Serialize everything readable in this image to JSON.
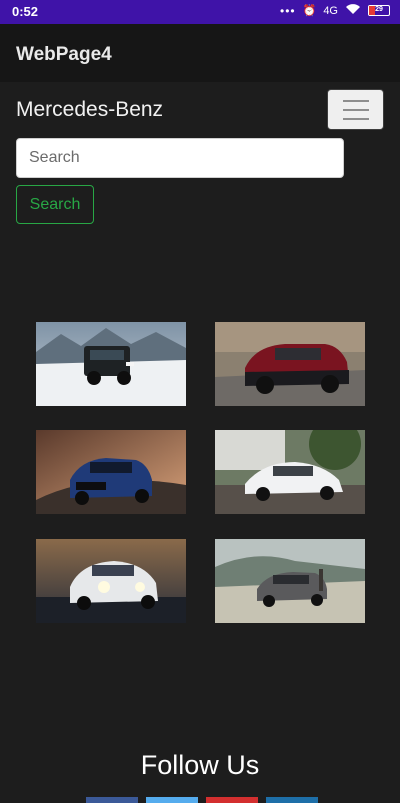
{
  "status_bar": {
    "time": "0:52",
    "network": "4G",
    "battery": "29"
  },
  "app_bar": {
    "title": "WebPage4"
  },
  "navbar": {
    "brand": "Mercedes-Benz"
  },
  "search": {
    "placeholder": "Search",
    "button_label": "Search"
  },
  "gallery": {
    "images": [
      {
        "name": "g-class-snow"
      },
      {
        "name": "maybach-gls-red"
      },
      {
        "name": "gle-blue-road"
      },
      {
        "name": "a-class-sedan-white"
      },
      {
        "name": "glc-white-headlights"
      },
      {
        "name": "eqc-coast"
      }
    ]
  },
  "footer": {
    "heading": "Follow Us",
    "social_colors": [
      "#3b5998",
      "#55acee",
      "#d32f2f",
      "#1e6fa8"
    ]
  }
}
